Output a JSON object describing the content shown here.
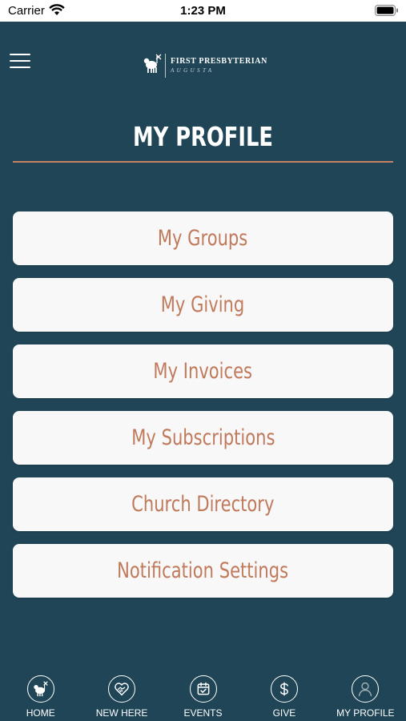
{
  "status_bar": {
    "carrier": "Carrier",
    "time": "1:23 PM"
  },
  "header": {
    "logo_line1": "FIRST PRESBYTERIAN",
    "logo_line2": "AUGUSTA"
  },
  "page": {
    "title": "MY PROFILE"
  },
  "menu": {
    "items": [
      {
        "label": "My Groups"
      },
      {
        "label": "My Giving"
      },
      {
        "label": "My Invoices"
      },
      {
        "label": "My Subscriptions"
      },
      {
        "label": "Church Directory"
      },
      {
        "label": "Notification Settings"
      }
    ]
  },
  "tabs": [
    {
      "label": "HOME",
      "icon": "lamb-icon"
    },
    {
      "label": "NEW HERE",
      "icon": "heart-handshake-icon"
    },
    {
      "label": "EVENTS",
      "icon": "calendar-check-icon"
    },
    {
      "label": "GIVE",
      "icon": "dollar-icon"
    },
    {
      "label": "MY PROFILE",
      "icon": "user-icon"
    }
  ],
  "colors": {
    "background": "#1f4556",
    "accent": "#c68265",
    "card": "#f8f8f8",
    "card_text": "#c07a5b"
  }
}
